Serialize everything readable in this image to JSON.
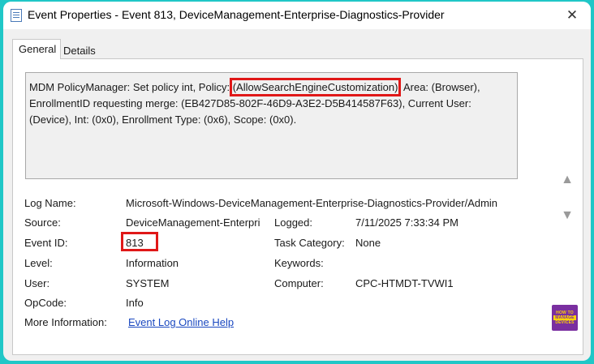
{
  "window": {
    "title": "Event Properties - Event 813, DeviceManagement-Enterprise-Diagnostics-Provider",
    "close_label": "✕"
  },
  "tabs": [
    {
      "label": "General",
      "selected": true
    },
    {
      "label": "Details",
      "selected": false
    }
  ],
  "message": {
    "before": "MDM PolicyManager: Set policy int, Policy: ",
    "highlighted": "(AllowSearchEngineCustomization)",
    "after": ", Area: (Browser), EnrollmentID requesting merge: (EB427D85-802F-46D9-A3E2-D5B414587F63), Current User: (Device), Int: (0x0), Enrollment Type: (0x6), Scope: (0x0)."
  },
  "fields": {
    "log_name": {
      "label": "Log Name:",
      "value": "Microsoft-Windows-DeviceManagement-Enterprise-Diagnostics-Provider/Admin"
    },
    "source": {
      "label": "Source:",
      "value": "DeviceManagement-Enterpri"
    },
    "logged": {
      "label": "Logged:",
      "value": "7/11/2025 7:33:34 PM"
    },
    "event_id": {
      "label": "Event ID:",
      "value": "813"
    },
    "task_category": {
      "label": "Task Category:",
      "value": "None"
    },
    "level": {
      "label": "Level:",
      "value": "Information"
    },
    "keywords": {
      "label": "Keywords:",
      "value": ""
    },
    "user": {
      "label": "User:",
      "value": "SYSTEM"
    },
    "computer": {
      "label": "Computer:",
      "value": "CPC-HTMDT-TVWI1"
    },
    "opcode": {
      "label": "OpCode:",
      "value": "Info"
    },
    "more_info": {
      "label": "More Information:",
      "link": "Event Log Online Help"
    }
  },
  "logo": {
    "line1": "HOW TO",
    "line2": "MANAGE",
    "line3": "DEVICES"
  },
  "colors": {
    "highlight": "#e01818",
    "link": "#1a48c0",
    "background": "#20c7c7"
  }
}
